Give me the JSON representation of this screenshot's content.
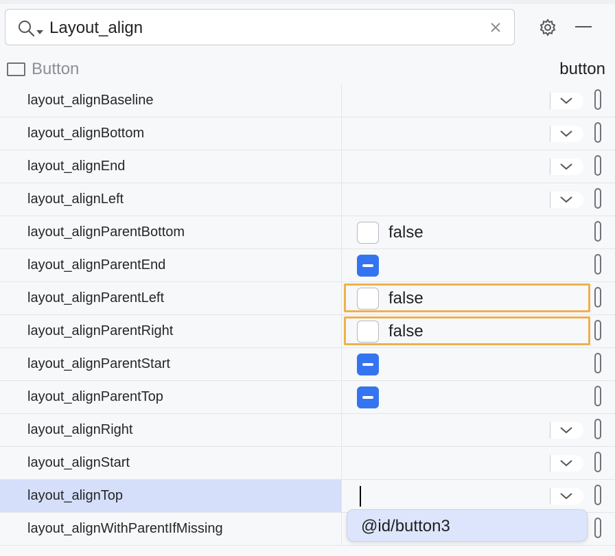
{
  "search": {
    "value": "Layout_align",
    "icon": "search-icon",
    "clear_icon": "close-icon"
  },
  "toolbar": {
    "settings_icon": "gear-icon",
    "collapse_icon": "minus-icon"
  },
  "component": {
    "type": "Button",
    "id": "button"
  },
  "rows": [
    {
      "name": "layout_alignBaseline",
      "kind": "dropdown"
    },
    {
      "name": "layout_alignBottom",
      "kind": "dropdown"
    },
    {
      "name": "layout_alignEnd",
      "kind": "dropdown"
    },
    {
      "name": "layout_alignLeft",
      "kind": "dropdown"
    },
    {
      "name": "layout_alignParentBottom",
      "kind": "checkbox",
      "value": "false"
    },
    {
      "name": "layout_alignParentEnd",
      "kind": "indeterminate"
    },
    {
      "name": "layout_alignParentLeft",
      "kind": "checkbox",
      "value": "false",
      "highlighted": true
    },
    {
      "name": "layout_alignParentRight",
      "kind": "checkbox",
      "value": "false",
      "highlighted": true
    },
    {
      "name": "layout_alignParentStart",
      "kind": "indeterminate"
    },
    {
      "name": "layout_alignParentTop",
      "kind": "indeterminate"
    },
    {
      "name": "layout_alignRight",
      "kind": "dropdown"
    },
    {
      "name": "layout_alignStart",
      "kind": "dropdown"
    },
    {
      "name": "layout_alignTop",
      "kind": "dropdown-editing",
      "selected": true
    },
    {
      "name": "layout_alignWithParentIfMissing",
      "kind": "none"
    }
  ],
  "completion_popup": {
    "items": [
      "@id/button3"
    ]
  },
  "colors": {
    "accent": "#3574f0",
    "highlight": "#f0b04c",
    "selected_row": "#d5dffa"
  }
}
